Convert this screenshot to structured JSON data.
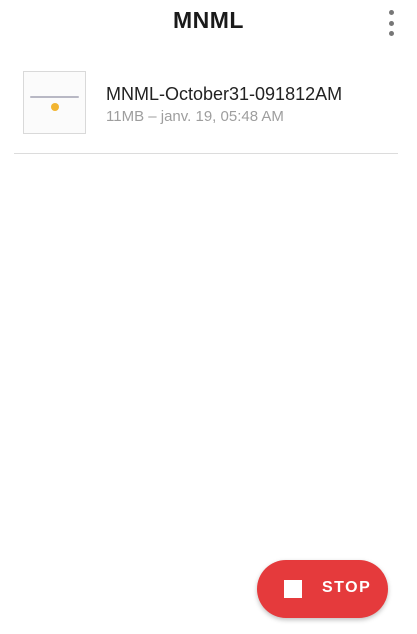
{
  "app": {
    "title": "MNML",
    "menu_icon": "more-vert-icon"
  },
  "recordings": [
    {
      "name": "MNML-October31-091812AM",
      "meta": "11MB – janv. 19, 05:48 AM",
      "thumbnail_icon": "video-thumbnail"
    }
  ],
  "fab": {
    "label": "STOP",
    "icon": "stop-icon",
    "color": "#e53a3c"
  }
}
